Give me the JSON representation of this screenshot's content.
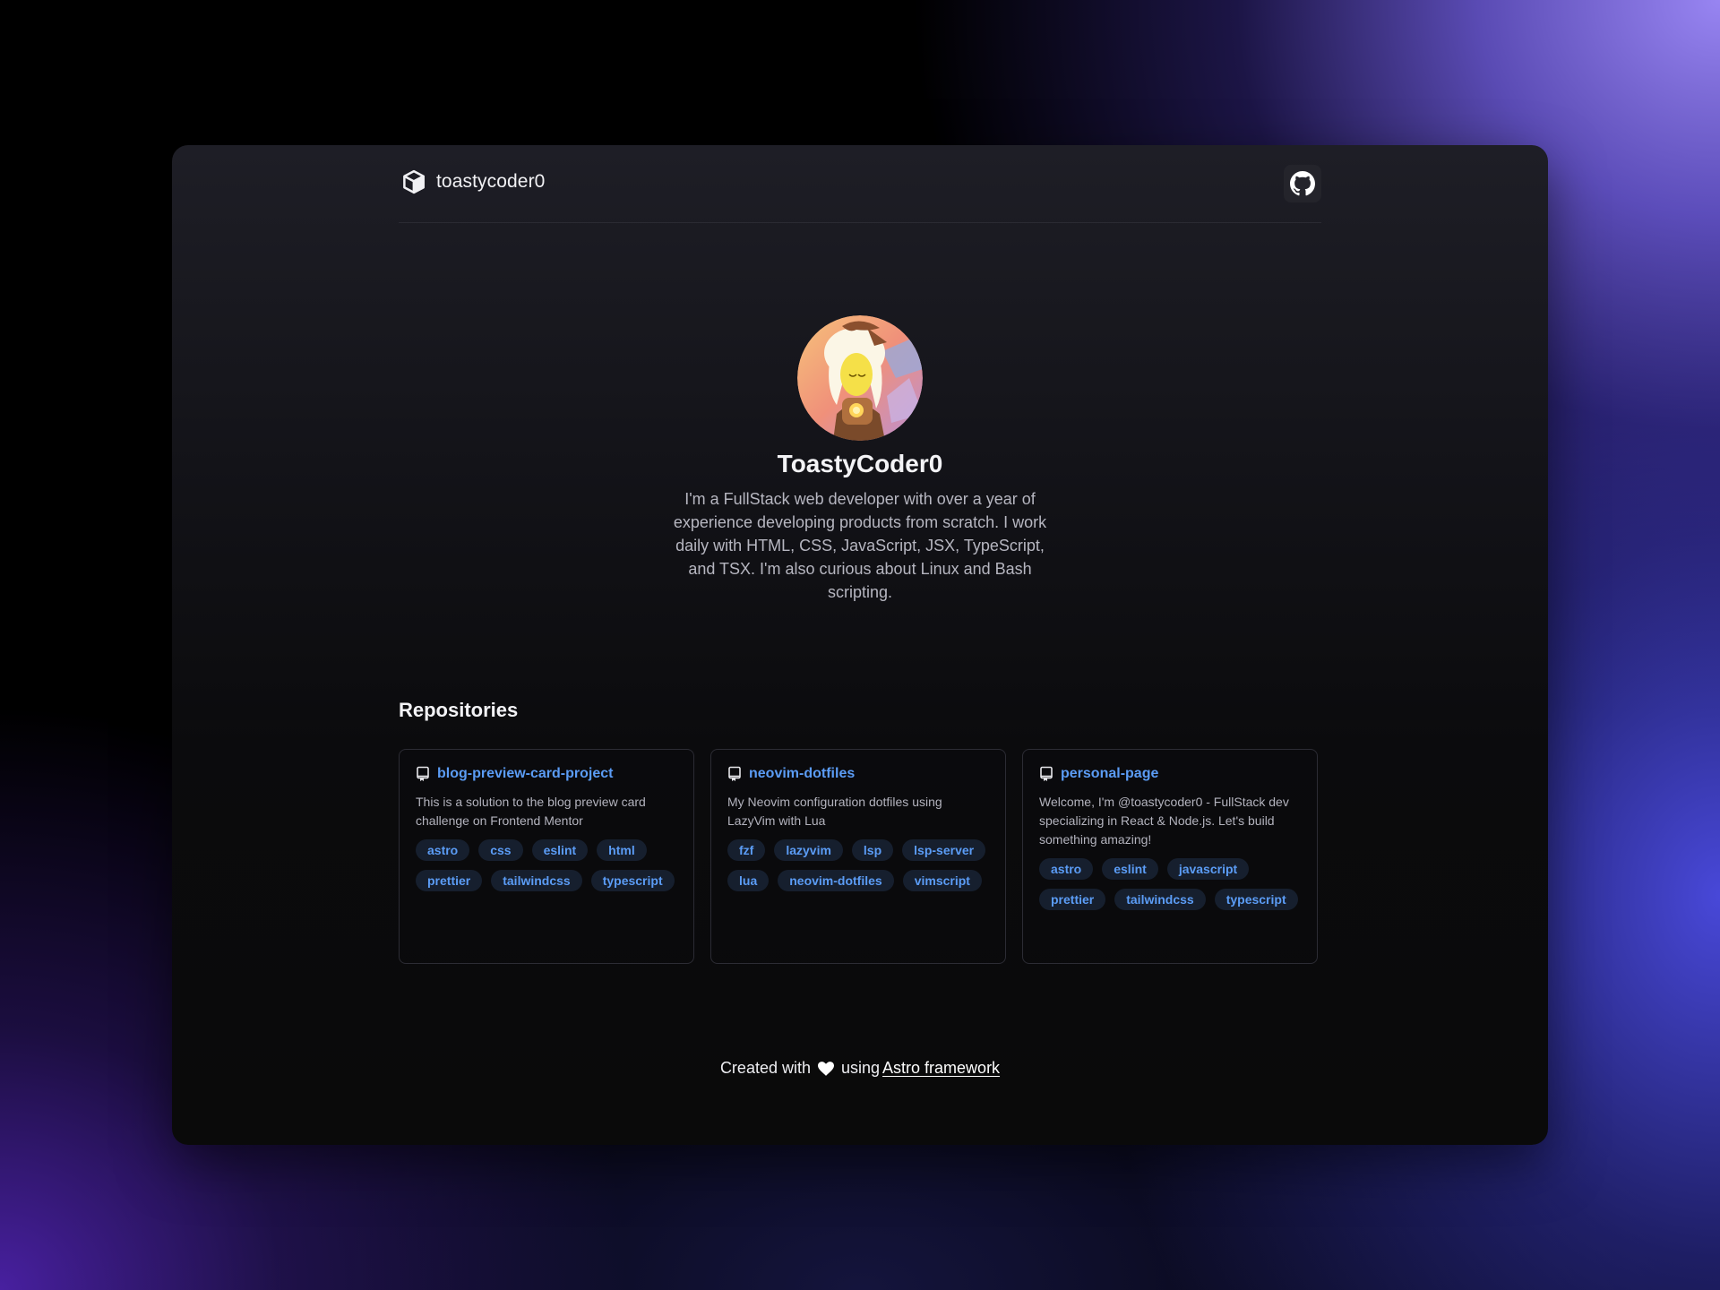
{
  "header": {
    "brand_name": "toastycoder0",
    "brand_icon": "cube-icon",
    "github_icon": "github-icon"
  },
  "profile": {
    "name": "ToastyCoder0",
    "bio": "I'm a FullStack web developer with over a year of experience developing products from scratch. I work daily with HTML, CSS, JavaScript, JSX, TypeScript, and TSX. I'm also curious about Linux and Bash scripting."
  },
  "repositories": {
    "title": "Repositories",
    "items": [
      {
        "name": "blog-preview-card-project",
        "description": "This is a solution to the blog preview card challenge on Frontend Mentor",
        "tags": [
          "astro",
          "css",
          "eslint",
          "html",
          "prettier",
          "tailwindcss",
          "typescript"
        ]
      },
      {
        "name": "neovim-dotfiles",
        "description": "My Neovim configuration dotfiles using LazyVim with Lua",
        "tags": [
          "fzf",
          "lazyvim",
          "lsp",
          "lsp-server",
          "lua",
          "neovim-dotfiles",
          "vimscript"
        ]
      },
      {
        "name": "personal-page",
        "description": "Welcome, I'm @toastycoder0 - FullStack dev specializing in React & Node.js. Let's build something amazing!",
        "tags": [
          "astro",
          "eslint",
          "javascript",
          "prettier",
          "tailwindcss",
          "typescript"
        ]
      }
    ]
  },
  "footer": {
    "prefix": "Created with",
    "middle": "using",
    "link_text": "Astro framework"
  },
  "colors": {
    "accent": "#5b9cf5",
    "tag_bg": "#161f2e",
    "card_border": "#2c2c34"
  }
}
